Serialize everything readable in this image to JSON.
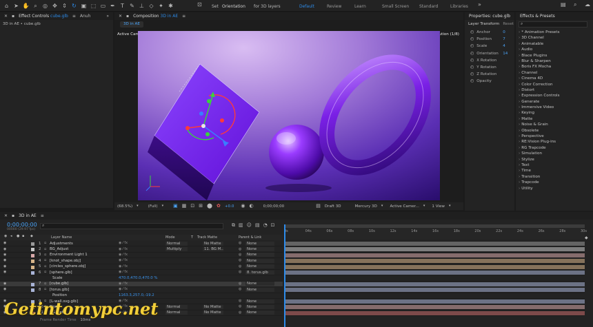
{
  "toolbar": {
    "snapping_label": "Set",
    "orientation_value": "Orientation",
    "for3d_label": "for 3D layers",
    "workspaces": [
      "Default",
      "Review",
      "Learn",
      "Small Screen",
      "Standard",
      "Libraries"
    ],
    "active_workspace": "Default"
  },
  "project_panel": {
    "tab_label": "Effect Controls",
    "tab_file": "cube.glb",
    "second_tab": "Anuh",
    "path": "3D in AE • cube.glb"
  },
  "composition_panel": {
    "tab_label": "Composition",
    "tab_name": "3D in AE",
    "breadcrumb": "3D in AE",
    "camera_label": "Active Camera (Default)",
    "resolution_label": "Adaptive Resolution (1/8)",
    "footer": {
      "zoom": "(68.5%)",
      "quality": "(Full)",
      "exposure": "+0.0",
      "timecode": "0;00;00;00",
      "draft3d": "Draft 3D",
      "renderer": "Mercury 3D",
      "camera": "Active Camer...",
      "views": "1 View"
    }
  },
  "properties_panel": {
    "title": "Properties: cube.glb",
    "section": "Layer Transform",
    "reset": "Reset",
    "rows": [
      {
        "label": "Anchor",
        "value": "0"
      },
      {
        "label": "Position",
        "value": "7"
      },
      {
        "label": "Scale",
        "value": "4"
      },
      {
        "label": "Orientation",
        "value": "14"
      },
      {
        "label": "X Rotation",
        "value": ""
      },
      {
        "label": "Y Rotation",
        "value": ""
      },
      {
        "label": "Z Rotation",
        "value": ""
      },
      {
        "label": "Opacity",
        "value": ""
      }
    ]
  },
  "effects_panel": {
    "title": "Effects & Presets",
    "search_placeholder": "",
    "items": [
      "* Animation Presets",
      "3D Channel",
      "Animatable",
      "Audio",
      "Blace Plugins",
      "Blur & Sharpen",
      "Boris FX Mocha",
      "Channel",
      "Cinema 4D",
      "Color Correction",
      "Distort",
      "Expression Controls",
      "Generate",
      "Immersive Video",
      "Keying",
      "Matte",
      "Noise & Grain",
      "Obsolete",
      "Perspective",
      "RE:Vision Plug-ins",
      "RG Trapcode",
      "Simulation",
      "Stylize",
      "Text",
      "Time",
      "Transition",
      "Trapcode",
      "Utility"
    ]
  },
  "timeline": {
    "tab": "3D in AE",
    "timecode": "0;00;00;00",
    "subtimecode": "00000 (29.97 fps)",
    "layer_name_header": "Layer Name",
    "mode_header": "Mode",
    "t_header": "T",
    "trackmatte_header": "Track Matte",
    "parent_header": "Parent & Link",
    "ticks": [
      "0s",
      "04s",
      "06s",
      "08s",
      "10s",
      "12s",
      "14s",
      "16s",
      "18s",
      "20s",
      "22s",
      "24s",
      "26s",
      "28s",
      "30s"
    ],
    "frame_render": "Frame Render Time",
    "frame_render_value": "10ms",
    "layers": [
      {
        "num": "1",
        "name": "Adjustments",
        "mode": "Normal",
        "matte": "No Matte",
        "parent": "None",
        "color": "#9a9a9a"
      },
      {
        "num": "2",
        "name": "BG_Adjust",
        "mode": "Multiply",
        "matte": "11. BG M...",
        "parent": "None",
        "color": "#c8c8c8"
      },
      {
        "num": "3",
        "name": "Environment Light 1",
        "mode": "",
        "matte": "",
        "parent": "None",
        "color": "#d7a9a9"
      },
      {
        "num": "4",
        "name": "[knot_shape.obj]",
        "mode": "",
        "matte": "",
        "parent": "None",
        "color": "#d7b58a"
      },
      {
        "num": "5",
        "name": "[circles_sphere.obj]",
        "mode": "",
        "matte": "",
        "parent": "None",
        "color": "#d7b58a"
      },
      {
        "num": "6",
        "name": "[sphere.glb]",
        "mode": "",
        "matte": "",
        "parent": "8. torus.glb",
        "color": "#a9b4d7"
      },
      {
        "num": "",
        "name": "Scale",
        "mode": "",
        "matte": "",
        "parent": "",
        "color": "",
        "value": "470.0,470.0,470.0 %"
      },
      {
        "num": "7",
        "name": "[cube.glb]",
        "mode": "",
        "matte": "",
        "parent": "None",
        "color": "#a9b4d7"
      },
      {
        "num": "8",
        "name": "[torus.glb]",
        "mode": "",
        "matte": "",
        "parent": "None",
        "color": "#a9b4d7"
      },
      {
        "num": "",
        "name": "Position",
        "mode": "",
        "matte": "",
        "parent": "",
        "color": "",
        "value": "1163.3,257.0,-19.2"
      },
      {
        "num": "9",
        "name": "[L-wall.svg.glb]",
        "mode": "",
        "matte": "",
        "parent": "None",
        "color": "#a9b4d7"
      },
      {
        "num": "10",
        "name": "Floor",
        "mode": "Normal",
        "matte": "No Matte",
        "parent": "None",
        "color": "#d7a9a9"
      },
      {
        "num": "11",
        "name": "BG Matte",
        "mode": "Normal",
        "matte": "No Matte",
        "parent": "None",
        "color": "#c96b6b"
      }
    ]
  },
  "watermark": "Getintomypc.net",
  "colors": {
    "accent": "#2d8ceb",
    "viewport_bg_top": "#c9a7ec",
    "viewport_bg_bottom": "#2a0e6e",
    "object_purple": "#7a20e6"
  }
}
